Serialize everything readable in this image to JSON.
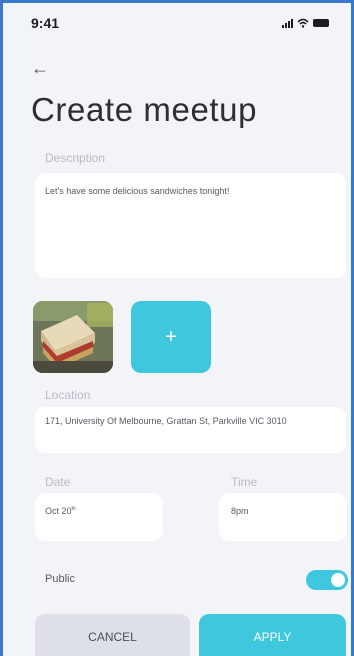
{
  "status_bar": {
    "time": "9:41"
  },
  "header": {
    "title": "Create meetup"
  },
  "description": {
    "label": "Description",
    "value": "Let's have some delicious sandwiches tonight!"
  },
  "media": {
    "add_label": "+"
  },
  "location": {
    "label": "Location",
    "value": "171, University Of Melbourne, Grattan St, Parkville VIC 3010"
  },
  "date": {
    "label": "Date",
    "value": "Oct 20",
    "suffix": "th"
  },
  "time": {
    "label": "Time",
    "value": "8pm"
  },
  "public": {
    "label": "Public",
    "enabled": true
  },
  "actions": {
    "cancel_label": "CANCEL",
    "apply_label": "APPLY"
  },
  "colors": {
    "accent": "#3ec7dd",
    "frame": "#3a78c9"
  }
}
